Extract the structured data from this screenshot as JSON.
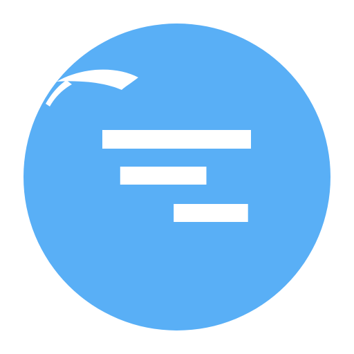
{
  "app_icon": {
    "name": "gantt-chart-app-icon",
    "background_color": "#ffffff",
    "circle_color": "#59aff6",
    "bar_color": "#ffffff",
    "highlight_color": "#ffffff",
    "task_bars": [
      {
        "id": "task-1",
        "start": 0.0,
        "end": 1.0
      },
      {
        "id": "task-2",
        "start": 0.12,
        "end": 0.7
      },
      {
        "id": "task-3",
        "start": 0.48,
        "end": 0.98
      }
    ]
  }
}
